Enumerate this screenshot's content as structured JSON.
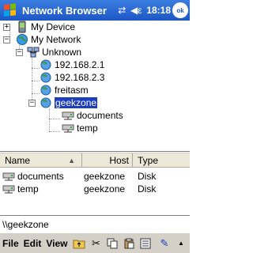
{
  "titlebar": {
    "title": "Network Browser",
    "time": "18:18",
    "ok": "ok",
    "icons": [
      "windows-start-icon",
      "connectivity-icon",
      "volume-icon"
    ]
  },
  "tree": {
    "my_device": "My Device",
    "my_network": "My Network",
    "unknown": "Unknown",
    "host1": "192.168.2.1",
    "host2": "192.168.2.3",
    "host3": "freitasm",
    "host4": "geekzone",
    "share1": "documents",
    "share2": "temp"
  },
  "list": {
    "columns": [
      "Name",
      "Host",
      "Type"
    ],
    "rows": [
      {
        "name": "documents",
        "host": "geekzone",
        "type": "Disk"
      },
      {
        "name": "temp",
        "host": "geekzone",
        "type": "Disk"
      }
    ]
  },
  "path": "\\\\geekzone",
  "menu": {
    "file": "File",
    "edit": "Edit",
    "view": "View"
  },
  "colors": {
    "titlebar": "#1d57c6",
    "selection": "#1d3fbf",
    "menubar": "#d4d0c8"
  }
}
